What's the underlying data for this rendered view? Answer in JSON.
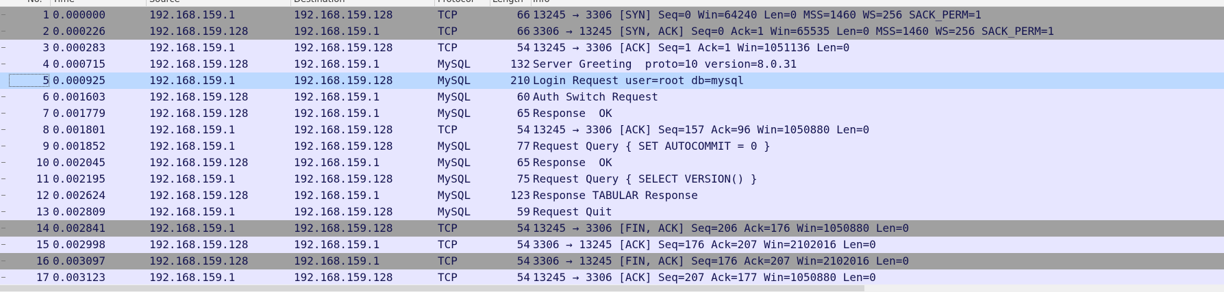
{
  "columns": {
    "no": "No.",
    "time": "Time",
    "source": "Source",
    "destination": "Destination",
    "protocol": "Protocol",
    "length": "Length",
    "info": "Info"
  },
  "colors": {
    "tcp_mysql_row": "#e7e6ff",
    "flag_row": "#a0a0a0",
    "selected_row": "#bcd9ff",
    "text": "#12124f"
  },
  "packets": [
    {
      "no": "1",
      "time": "0.000000",
      "src": "192.168.159.1",
      "dst": "192.168.159.128",
      "proto": "TCP",
      "len": "66",
      "info": "13245 → 3306 [SYN] Seq=0 Win=64240 Len=0 MSS=1460 WS=256 SACK_PERM=1",
      "style": "dark"
    },
    {
      "no": "2",
      "time": "0.000226",
      "src": "192.168.159.128",
      "dst": "192.168.159.1",
      "proto": "TCP",
      "len": "66",
      "info": "3306 → 13245 [SYN, ACK] Seq=0 Ack=1 Win=65535 Len=0 MSS=1460 WS=256 SACK_PERM=1",
      "style": "dark"
    },
    {
      "no": "3",
      "time": "0.000283",
      "src": "192.168.159.1",
      "dst": "192.168.159.128",
      "proto": "TCP",
      "len": "54",
      "info": "13245 → 3306 [ACK] Seq=1 Ack=1 Win=1051136 Len=0",
      "style": "tcp"
    },
    {
      "no": "4",
      "time": "0.000715",
      "src": "192.168.159.128",
      "dst": "192.168.159.1",
      "proto": "MySQL",
      "len": "132",
      "info": "Server Greeting  proto=10 version=8.0.31",
      "style": "mysql"
    },
    {
      "no": "5",
      "time": "0.000925",
      "src": "192.168.159.1",
      "dst": "192.168.159.128",
      "proto": "MySQL",
      "len": "210",
      "info": "Login Request user=root db=mysql",
      "style": "selected"
    },
    {
      "no": "6",
      "time": "0.001603",
      "src": "192.168.159.128",
      "dst": "192.168.159.1",
      "proto": "MySQL",
      "len": "60",
      "info": "Auth Switch Request",
      "style": "mysql"
    },
    {
      "no": "7",
      "time": "0.001779",
      "src": "192.168.159.128",
      "dst": "192.168.159.1",
      "proto": "MySQL",
      "len": "65",
      "info": "Response  OK",
      "style": "mysql"
    },
    {
      "no": "8",
      "time": "0.001801",
      "src": "192.168.159.1",
      "dst": "192.168.159.128",
      "proto": "TCP",
      "len": "54",
      "info": "13245 → 3306 [ACK] Seq=157 Ack=96 Win=1050880 Len=0",
      "style": "tcp"
    },
    {
      "no": "9",
      "time": "0.001852",
      "src": "192.168.159.1",
      "dst": "192.168.159.128",
      "proto": "MySQL",
      "len": "77",
      "info": "Request Query { SET AUTOCOMMIT = 0 }",
      "style": "mysql"
    },
    {
      "no": "10",
      "time": "0.002045",
      "src": "192.168.159.128",
      "dst": "192.168.159.1",
      "proto": "MySQL",
      "len": "65",
      "info": "Response  OK",
      "style": "mysql"
    },
    {
      "no": "11",
      "time": "0.002195",
      "src": "192.168.159.1",
      "dst": "192.168.159.128",
      "proto": "MySQL",
      "len": "75",
      "info": "Request Query { SELECT VERSION() }",
      "style": "mysql"
    },
    {
      "no": "12",
      "time": "0.002624",
      "src": "192.168.159.128",
      "dst": "192.168.159.1",
      "proto": "MySQL",
      "len": "123",
      "info": "Response TABULAR Response",
      "style": "mysql"
    },
    {
      "no": "13",
      "time": "0.002809",
      "src": "192.168.159.1",
      "dst": "192.168.159.128",
      "proto": "MySQL",
      "len": "59",
      "info": "Request Quit",
      "style": "mysql"
    },
    {
      "no": "14",
      "time": "0.002841",
      "src": "192.168.159.1",
      "dst": "192.168.159.128",
      "proto": "TCP",
      "len": "54",
      "info": "13245 → 3306 [FIN, ACK] Seq=206 Ack=176 Win=1050880 Len=0",
      "style": "dark"
    },
    {
      "no": "15",
      "time": "0.002998",
      "src": "192.168.159.128",
      "dst": "192.168.159.1",
      "proto": "TCP",
      "len": "54",
      "info": "3306 → 13245 [ACK] Seq=176 Ack=207 Win=2102016 Len=0",
      "style": "tcp"
    },
    {
      "no": "16",
      "time": "0.003097",
      "src": "192.168.159.128",
      "dst": "192.168.159.1",
      "proto": "TCP",
      "len": "54",
      "info": "3306 → 13245 [FIN, ACK] Seq=176 Ack=207 Win=2102016 Len=0",
      "style": "dark"
    },
    {
      "no": "17",
      "time": "0.003123",
      "src": "192.168.159.1",
      "dst": "192.168.159.128",
      "proto": "TCP",
      "len": "54",
      "info": "13245 → 3306 [ACK] Seq=207 Ack=177 Win=1050880 Len=0",
      "style": "tcp"
    }
  ]
}
